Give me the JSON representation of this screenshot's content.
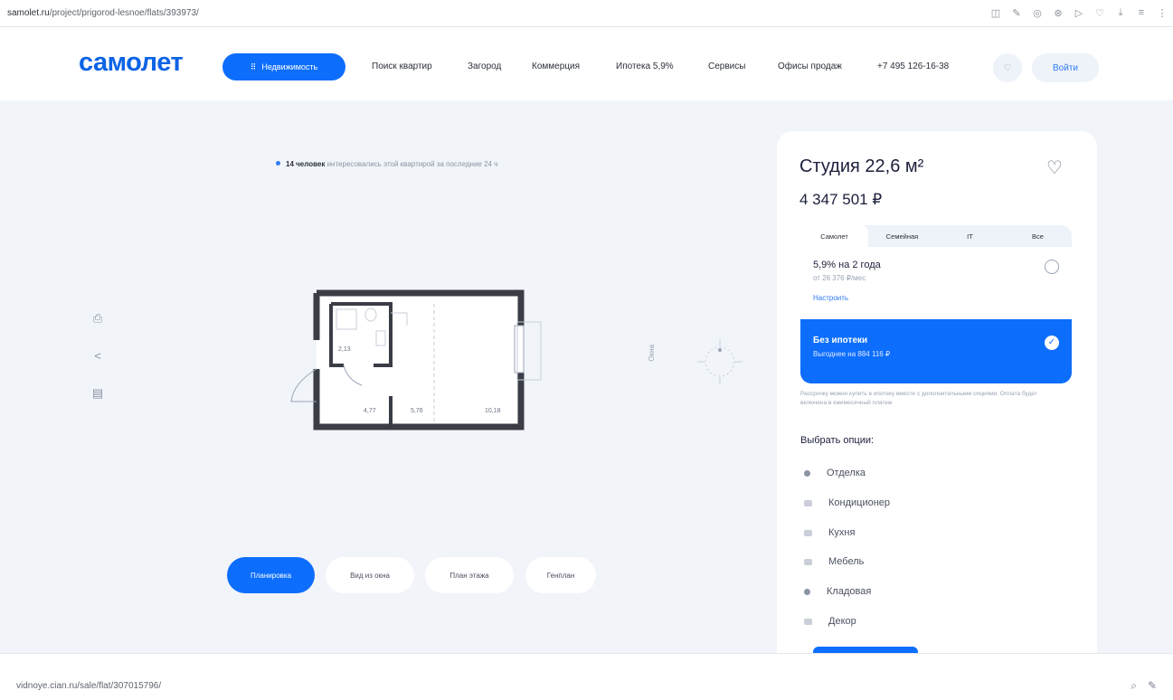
{
  "browser": {
    "url_domain": "samolet.ru",
    "url_path": "/project/prigorod-lesnoe/flats/393973/",
    "icons": [
      "reader-icon",
      "edit-icon",
      "translate-icon",
      "extension-icon",
      "play-icon",
      "favorite-icon",
      "download-icon",
      "tabs-icon",
      "menu-icon"
    ]
  },
  "header": {
    "logo": "самолет",
    "realty_button": "Недвижимость",
    "nav": [
      "Поиск квартир",
      "Загород",
      "Коммерция",
      "Ипотека 5,9%",
      "Сервисы",
      "Офисы продаж",
      "+7 495 126-16-38"
    ],
    "login": "Войти"
  },
  "plan_area": {
    "viewers_count": "14 человек",
    "viewers_text": "интересовались этой квартирой за последние 24 ч",
    "rooms": {
      "bath": "2,13",
      "hall": "4,77",
      "kitchen": "5,76",
      "room": "10,18"
    },
    "side_label": "Окна",
    "view_tabs": [
      "Планировка",
      "Вид из окна",
      "План этажа",
      "Генплан"
    ]
  },
  "card": {
    "title": "Студия 22,6 м²",
    "price": "4 347 501 ₽",
    "mortgage_tabs": [
      "Самолет",
      "Семейная",
      "IT",
      "Все"
    ],
    "mortgage_option": {
      "rate": "5,9% на 2 года",
      "monthly": "от 26 376 ₽/мес",
      "configure": "Настроить"
    },
    "no_mortgage": {
      "title": "Без ипотеки",
      "benefit": "Выгоднее на 884 116 ₽"
    },
    "note": "Рассрочку можно купить в ипотеку вместе с дополнительными опциями. Оплата будет включена в ежемесячный платеж",
    "options_title": "Выбрать опции:",
    "options": [
      "Отделка",
      "Кондиционер",
      "Кухня",
      "Мебель",
      "Кладовая",
      "Декор"
    ]
  },
  "status": {
    "url_domain": "vidnoye.cian.ru",
    "url_path": "/sale/flat/307015796/"
  }
}
